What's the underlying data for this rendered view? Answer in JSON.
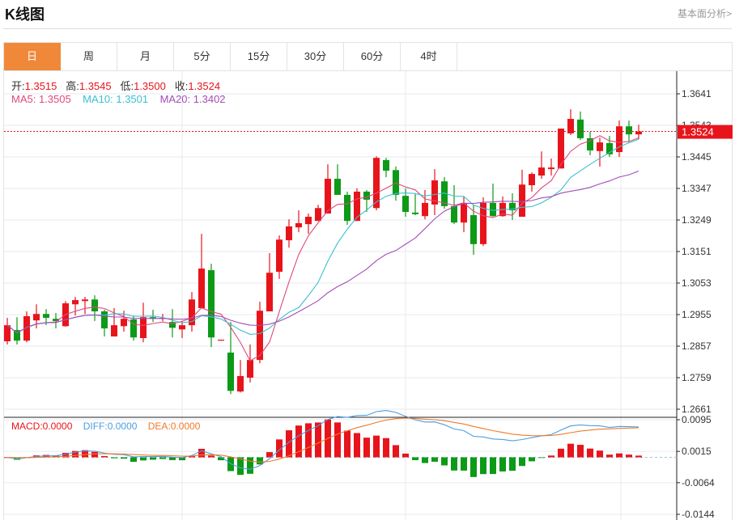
{
  "header": {
    "title": "K线图",
    "link": "基本面分析>"
  },
  "tabs": [
    {
      "label": "日",
      "active": true
    },
    {
      "label": "周"
    },
    {
      "label": "月"
    },
    {
      "label": "5分"
    },
    {
      "label": "15分"
    },
    {
      "label": "30分"
    },
    {
      "label": "60分"
    },
    {
      "label": "4时"
    }
  ],
  "legend": {
    "open_label": "开:",
    "open": "1.3515",
    "high_label": "高:",
    "high": "1.3545",
    "low_label": "低:",
    "low": "1.3500",
    "close_label": "收:",
    "close": "1.3524",
    "ma5": "MA5: 1.3505",
    "ma10": "MA10: 1.3501",
    "ma20": "MA20: 1.3402"
  },
  "macd_legend": {
    "macd": "MACD:0.0000",
    "diff": "DIFF:0.0000",
    "dea": "DEA:0.0000"
  },
  "colors": {
    "up": "#e8141b",
    "down": "#0c9a17",
    "ma5": "#e0487c",
    "ma10": "#3cbfd0",
    "ma20": "#a24db6",
    "diff": "#4a9fe0",
    "dea": "#f07a2a",
    "accent": "#f0883a"
  },
  "chart_data": {
    "type": "candlestick",
    "price_ticks": [
      "1.3641",
      "1.3543",
      "1.3445",
      "1.3347",
      "1.3249",
      "1.3151",
      "1.3053",
      "1.2955",
      "1.2857",
      "1.2759",
      "1.2661"
    ],
    "price_range": [
      1.2661,
      1.3641
    ],
    "last_price": "1.3524",
    "macd_ticks": [
      "0.0095",
      "0.0015",
      "-0.0064",
      "-0.0144"
    ],
    "macd_range": [
      -0.0144,
      0.0095
    ],
    "ohlc": [
      [
        1.2872,
        1.2945,
        1.2862,
        1.2922
      ],
      [
        1.2907,
        1.2947,
        1.2862,
        1.2874
      ],
      [
        1.2874,
        1.2965,
        1.2869,
        1.295
      ],
      [
        1.2937,
        1.2987,
        1.2912,
        1.2957
      ],
      [
        1.2957,
        1.2972,
        1.2922,
        1.2945
      ],
      [
        1.2942,
        1.296,
        1.2912,
        1.2935
      ],
      [
        1.2919,
        1.2997,
        1.2917,
        1.299
      ],
      [
        1.2987,
        1.301,
        1.2952,
        1.3
      ],
      [
        1.2997,
        1.301,
        1.2957,
        1.3002
      ],
      [
        1.3002,
        1.3015,
        1.2935,
        1.2965
      ],
      [
        1.2965,
        1.297,
        1.2887,
        1.2912
      ],
      [
        1.2887,
        1.2975,
        1.2887,
        1.2922
      ],
      [
        1.2919,
        1.2967,
        1.2902,
        1.2942
      ],
      [
        1.294,
        1.2952,
        1.2874,
        1.2884
      ],
      [
        1.2882,
        1.2992,
        1.2869,
        1.2947
      ],
      [
        1.2947,
        1.297,
        1.2932,
        1.2942
      ],
      [
        1.2943,
        1.2957,
        1.2935,
        1.2945
      ],
      [
        1.2932,
        1.2972,
        1.2884,
        1.2914
      ],
      [
        1.2909,
        1.2935,
        1.2882,
        1.2922
      ],
      [
        1.2922,
        1.3025,
        1.2902,
        1.3002
      ],
      [
        1.2975,
        1.3206,
        1.2975,
        1.3098
      ],
      [
        1.3093,
        1.3113,
        1.2854,
        1.2884
      ],
      [
        1.2874,
        1.2877,
        1.2874,
        1.2877
      ],
      [
        1.2837,
        1.2932,
        1.2708,
        1.2718
      ],
      [
        1.2716,
        1.2814,
        1.2713,
        1.2764
      ],
      [
        1.2759,
        1.2862,
        1.2744,
        1.2814
      ],
      [
        1.2814,
        1.2995,
        1.2804,
        1.2967
      ],
      [
        1.2965,
        1.3146,
        1.2965,
        1.3085
      ],
      [
        1.3088,
        1.3201,
        1.3066,
        1.3188
      ],
      [
        1.3186,
        1.3251,
        1.3163,
        1.3229
      ],
      [
        1.3226,
        1.3279,
        1.3211,
        1.3239
      ],
      [
        1.3236,
        1.3269,
        1.3206,
        1.3259
      ],
      [
        1.3246,
        1.3296,
        1.3246,
        1.3286
      ],
      [
        1.3269,
        1.3422,
        1.3269,
        1.3377
      ],
      [
        1.3377,
        1.3422,
        1.3327,
        1.3327
      ],
      [
        1.3327,
        1.3337,
        1.3234,
        1.3246
      ],
      [
        1.3246,
        1.3347,
        1.3246,
        1.3337
      ],
      [
        1.3337,
        1.3342,
        1.3274,
        1.3312
      ],
      [
        1.3286,
        1.3447,
        1.3279,
        1.3442
      ],
      [
        1.3435,
        1.3442,
        1.3382,
        1.3402
      ],
      [
        1.3404,
        1.3415,
        1.3309,
        1.3327
      ],
      [
        1.3324,
        1.3347,
        1.3259,
        1.3274
      ],
      [
        1.3272,
        1.3329,
        1.3264,
        1.3267
      ],
      [
        1.3261,
        1.3342,
        1.3251,
        1.3302
      ],
      [
        1.3297,
        1.3407,
        1.3264,
        1.3372
      ],
      [
        1.3369,
        1.3382,
        1.3284,
        1.3292
      ],
      [
        1.3292,
        1.3357,
        1.3236,
        1.3241
      ],
      [
        1.3241,
        1.3322,
        1.3211,
        1.3302
      ],
      [
        1.3264,
        1.3296,
        1.3141,
        1.3174
      ],
      [
        1.3174,
        1.3319,
        1.3168,
        1.3302
      ],
      [
        1.3302,
        1.3362,
        1.3259,
        1.3261
      ],
      [
        1.3261,
        1.3322,
        1.3259,
        1.3302
      ],
      [
        1.3302,
        1.3332,
        1.3249,
        1.3279
      ],
      [
        1.3259,
        1.3405,
        1.3259,
        1.3359
      ],
      [
        1.3357,
        1.3397,
        1.3337,
        1.3392
      ],
      [
        1.3387,
        1.3462,
        1.3377,
        1.3412
      ],
      [
        1.3407,
        1.344,
        1.3387,
        1.3412
      ],
      [
        1.3409,
        1.3533,
        1.3409,
        1.3533
      ],
      [
        1.3518,
        1.3593,
        1.3513,
        1.3563
      ],
      [
        1.3561,
        1.3586,
        1.3498,
        1.3503
      ],
      [
        1.3503,
        1.3523,
        1.345,
        1.3465
      ],
      [
        1.3463,
        1.3505,
        1.3415,
        1.349
      ],
      [
        1.3488,
        1.351,
        1.3445,
        1.3453
      ],
      [
        1.346,
        1.3558,
        1.3445,
        1.354
      ],
      [
        1.354,
        1.3558,
        1.3493,
        1.3515
      ],
      [
        1.3515,
        1.3545,
        1.35,
        1.3524
      ]
    ],
    "ohlc_order": [
      "open",
      "high",
      "low",
      "close"
    ],
    "moving_averages": [
      5,
      10,
      20
    ],
    "grid": true
  }
}
